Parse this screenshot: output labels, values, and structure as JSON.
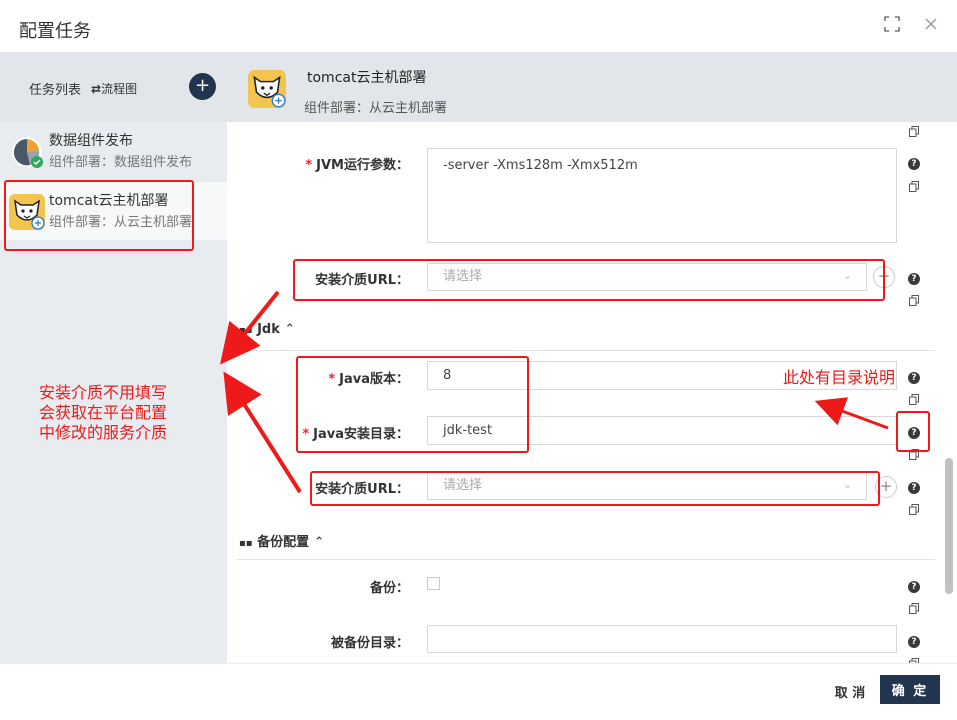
{
  "dialog": {
    "title": "配置任务",
    "fullscreen_icon": "fullscreen-icon",
    "close_icon": "close-icon"
  },
  "sidebar": {
    "header_label": "任务列表",
    "flow_label": "流程图",
    "add_icon": "plus-icon",
    "tasks": [
      {
        "name": "数据组件发布",
        "sub": "组件部署：数据组件发布",
        "icon": "pie-chart-icon"
      },
      {
        "name": "tomcat云主机部署",
        "sub": "组件部署：从云主机部署",
        "icon": "tomcat-icon"
      }
    ]
  },
  "main": {
    "task_name": "tomcat云主机部署",
    "task_sub": "组件部署：从云主机部署"
  },
  "form": {
    "jvm_label": "JVM运行参数：",
    "jvm_value": "-server -Xms128m -Xmx512m",
    "media_url_label": "安装介质URL：",
    "media_url_placeholder": "请选择",
    "jdk_section": "Jdk",
    "java_version_label": "Java版本：",
    "java_version_value": "8",
    "java_dir_label": "Java安装目录：",
    "java_dir_value": "jdk-test",
    "media_url_label_2": "安装介质URL：",
    "media_url_placeholder_2": "请选择",
    "backup_section": "备份配置",
    "backup_label": "备份：",
    "backup_dir_label": "被备份目录：",
    "backup_dir_value": ""
  },
  "footer": {
    "cancel_label": "取 消",
    "ok_label": "确 定"
  },
  "annotations": {
    "left_note_lines": [
      "安装介质不用填写",
      "会获取在平台配置",
      "中修改的服务介质"
    ],
    "right_note": "此处有目录说明",
    "color": "#ee1a1a"
  }
}
